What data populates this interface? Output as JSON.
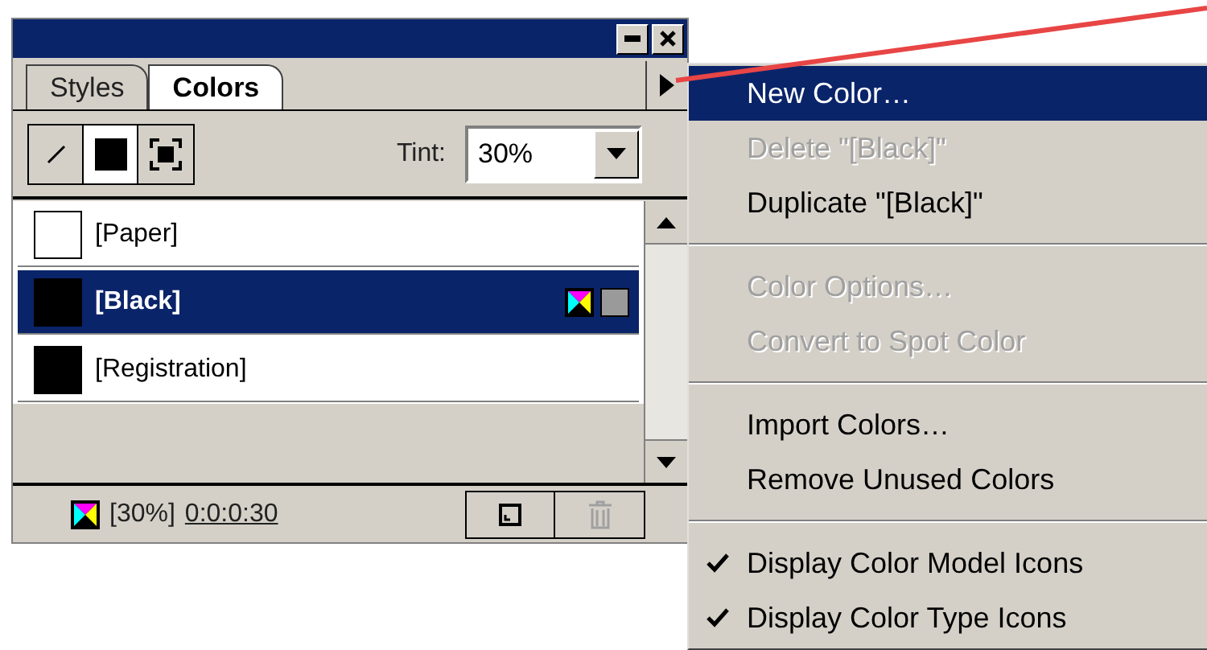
{
  "panel": {
    "tabs": [
      {
        "label": "Styles",
        "selected": false
      },
      {
        "label": "Colors",
        "selected": true
      }
    ],
    "modes": [
      {
        "kind": "stroke",
        "selected": false
      },
      {
        "kind": "fill",
        "selected": true
      },
      {
        "kind": "container",
        "selected": false
      }
    ],
    "tint": {
      "label": "Tint:",
      "value": "30%"
    },
    "swatches": [
      {
        "name": "[Paper]",
        "color": "#ffffff",
        "selected": false,
        "type_icons": false
      },
      {
        "name": "[Black]",
        "color": "#000000",
        "selected": true,
        "type_icons": true
      },
      {
        "name": "[Registration]",
        "color": "#000000",
        "selected": false,
        "type_icons": false
      }
    ],
    "footer": {
      "tint": "[30%]",
      "values": "0:0:0:30"
    }
  },
  "menu": {
    "groups": [
      [
        {
          "label": "New Color…",
          "selected": true,
          "disabled": false,
          "checked": false
        },
        {
          "label": "Delete \"[Black]\"",
          "selected": false,
          "disabled": true,
          "checked": false
        },
        {
          "label": "Duplicate \"[Black]\"",
          "selected": false,
          "disabled": false,
          "checked": false
        }
      ],
      [
        {
          "label": "Color Options…",
          "selected": false,
          "disabled": true,
          "checked": false
        },
        {
          "label": "Convert to Spot Color",
          "selected": false,
          "disabled": true,
          "checked": false
        }
      ],
      [
        {
          "label": "Import Colors…",
          "selected": false,
          "disabled": false,
          "checked": false
        },
        {
          "label": "Remove Unused Colors",
          "selected": false,
          "disabled": false,
          "checked": false
        }
      ],
      [
        {
          "label": "Display Color Model Icons",
          "selected": false,
          "disabled": false,
          "checked": true
        },
        {
          "label": "Display Color Type Icons",
          "selected": false,
          "disabled": false,
          "checked": true
        }
      ]
    ]
  }
}
